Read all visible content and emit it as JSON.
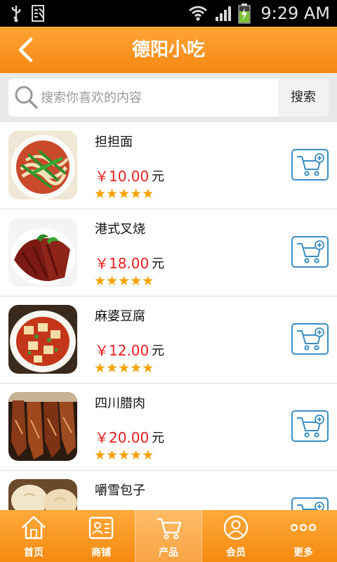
{
  "status_bar": {
    "time": "9:29 AM"
  },
  "header": {
    "title": "德阳小吃"
  },
  "search": {
    "placeholder": "搜索你喜欢的内容",
    "button_label": "搜索"
  },
  "products": [
    {
      "name": "担担面",
      "price": "￥10.00",
      "unit": "元",
      "rating": "★★★★★"
    },
    {
      "name": "港式叉烧",
      "price": "￥18.00",
      "unit": "元",
      "rating": "★★★★★"
    },
    {
      "name": "麻婆豆腐",
      "price": "￥12.00",
      "unit": "元",
      "rating": "★★★★★"
    },
    {
      "name": "四川腊肉",
      "price": "￥20.00",
      "unit": "元",
      "rating": "★★★★★"
    },
    {
      "name": "嚼雪包子",
      "price": "",
      "unit": "",
      "rating": ""
    }
  ],
  "bottom_nav": [
    {
      "label": "首页",
      "icon": "home-icon"
    },
    {
      "label": "商铺",
      "icon": "store-icon"
    },
    {
      "label": "产品",
      "icon": "cart-icon",
      "active": true
    },
    {
      "label": "会员",
      "icon": "member-icon"
    },
    {
      "label": "更多",
      "icon": "more-icon"
    }
  ],
  "colors": {
    "header_orange": "#f78713",
    "price_red": "#ee1c1c",
    "star_orange": "#f5a000",
    "cart_blue": "#3a8ec4"
  }
}
